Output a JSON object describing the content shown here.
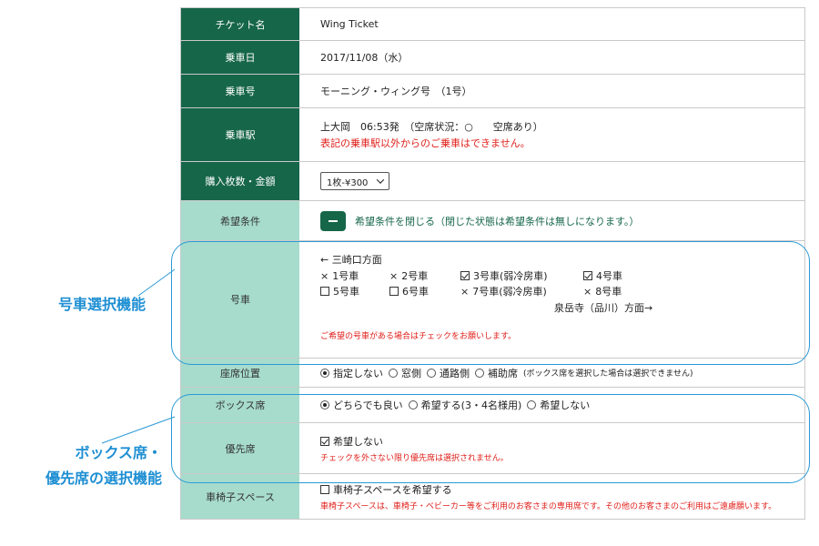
{
  "rows": {
    "ticket_name": {
      "label": "チケット名",
      "value": "Wing Ticket"
    },
    "boarding_date": {
      "label": "乗車日",
      "value": "2017/11/08（水）"
    },
    "train": {
      "label": "乗車号",
      "value": "モーニング・ウィング号　（1号）"
    },
    "station": {
      "label": "乗車駅",
      "value": "上大岡　06:53発　（空席状況：○　　空席あり）",
      "note": "表記の乗車駅以外からのご乗車はできません。"
    },
    "quantity": {
      "label": "購入枚数・金額",
      "selected": "1枚-¥300"
    },
    "preference": {
      "label": "希望条件",
      "toggle_text": "希望条件を閉じる（閉じた状態は希望条件は無しになります。）"
    },
    "car": {
      "label": "号車",
      "direction_left": "← 三崎口方面",
      "cars": [
        {
          "mark": "x",
          "label": "1号車"
        },
        {
          "mark": "x",
          "label": "2号車"
        },
        {
          "mark": "checked",
          "label": "3号車(弱冷房車)"
        },
        {
          "mark": "checked",
          "label": "4号車"
        },
        {
          "mark": "unchecked",
          "label": "5号車"
        },
        {
          "mark": "unchecked",
          "label": "6号車"
        },
        {
          "mark": "x",
          "label": "7号車(弱冷房車)"
        },
        {
          "mark": "x",
          "label": "8号車"
        }
      ],
      "direction_right": "泉岳寺（品川）方面→",
      "note": "ご希望の号車がある場合はチェックをお願いします。"
    },
    "seat_position": {
      "label": "座席位置",
      "options": [
        "指定しない",
        "窓側",
        "通路側",
        "補助席"
      ],
      "selected_index": 0,
      "note": "(ボックス席を選択した場合は選択できません)"
    },
    "box_seat": {
      "label": "ボックス席",
      "options": [
        "どちらでも良い",
        "希望する(3・4名様用)",
        "希望しない"
      ],
      "selected_index": 0
    },
    "priority_seat": {
      "label": "優先席",
      "checkbox_label": "希望しない",
      "checked": true,
      "note": "チェックを外さない限り優先席は選択されません。"
    },
    "wheelchair": {
      "label": "車椅子スペース",
      "checkbox_label": "車椅子スペースを希望する",
      "checked": false,
      "note": "車椅子スペースは、車椅子・ベビーカー等をご利用のお客さまの専用席です。その他のお客さまのご利用はご遠慮願います。"
    }
  },
  "callouts": {
    "car_selection": "号車選択機能",
    "box_priority_line1": "ボックス席・",
    "box_priority_line2": "優先席の選択機能"
  },
  "colors": {
    "header_dark": "#16664a",
    "header_light": "#a7dccc",
    "accent_blue": "#2b9ad6",
    "warning_red": "#e0201b"
  }
}
